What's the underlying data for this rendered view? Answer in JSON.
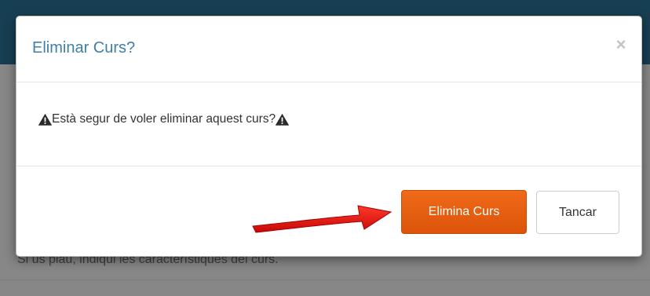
{
  "background": {
    "hint_text": "Si us plau, indiqui les característiques del curs."
  },
  "modal": {
    "title": "Eliminar Curs?",
    "close_label": "×",
    "message": "Està segur de voler eliminar aquest curs?",
    "confirm_label": "Elimina Curs",
    "cancel_label": "Tancar"
  },
  "colors": {
    "header_bar": "#173f53",
    "title": "#3f80a8",
    "confirm_button": "#e85e10",
    "arrow": "#e01010"
  },
  "icons": {
    "warning": "warning-icon",
    "close": "close-icon",
    "annotation_arrow": "arrow-annotation-icon"
  }
}
